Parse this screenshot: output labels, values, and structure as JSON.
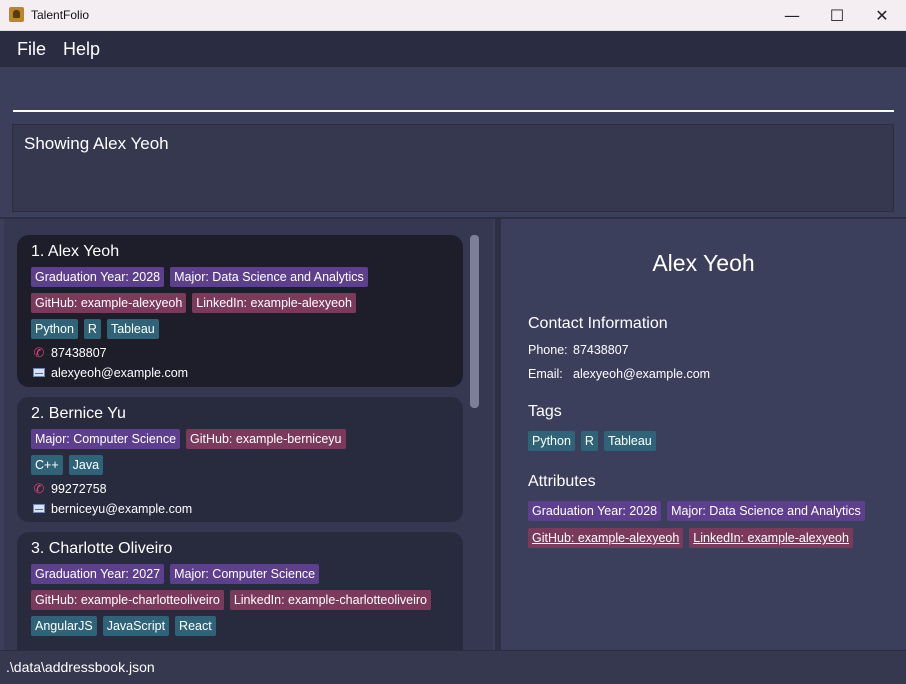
{
  "window": {
    "title": "TalentFolio",
    "minimize": "—",
    "maximize": "☐",
    "close": "✕"
  },
  "menu": {
    "file": "File",
    "help": "Help"
  },
  "command": {
    "value": ""
  },
  "result": {
    "text": "Showing Alex Yeoh"
  },
  "persons": [
    {
      "name": "1. Alex Yeoh",
      "attributes": [
        {
          "text": "Graduation Year: 2028",
          "color": "purple"
        },
        {
          "text": "Major: Data Science and Analytics",
          "color": "purple"
        },
        {
          "text": "GitHub: example-alexyeoh",
          "color": "maroon"
        },
        {
          "text": "LinkedIn: example-alexyeoh",
          "color": "maroon"
        }
      ],
      "tags": [
        "Python",
        "R",
        "Tableau"
      ],
      "phone": "87438807",
      "email": "alexyeoh@example.com"
    },
    {
      "name": "2. Bernice Yu",
      "attributes": [
        {
          "text": "Major: Computer Science",
          "color": "purple"
        },
        {
          "text": "GitHub: example-berniceyu",
          "color": "maroon"
        }
      ],
      "tags": [
        "C++",
        "Java"
      ],
      "phone": "99272758",
      "email": "berniceyu@example.com"
    },
    {
      "name": "3. Charlotte Oliveiro",
      "attributes": [
        {
          "text": "Graduation Year: 2027",
          "color": "purple"
        },
        {
          "text": "Major: Computer Science",
          "color": "purple"
        },
        {
          "text": "GitHub: example-charlotteoliveiro",
          "color": "maroon"
        },
        {
          "text": "LinkedIn: example-charlotteoliveiro",
          "color": "maroon"
        }
      ],
      "tags": [
        "AngularJS",
        "JavaScript",
        "React"
      ]
    }
  ],
  "detail": {
    "name": "Alex Yeoh",
    "contact_heading": "Contact Information",
    "phone_label": "Phone:",
    "phone": "87438807",
    "email_label": "Email:",
    "email": "alexyeoh@example.com",
    "tags_heading": "Tags",
    "tags": [
      "Python",
      "R",
      "Tableau"
    ],
    "attributes_heading": "Attributes",
    "attributes": [
      "Graduation Year: 2028",
      "Major: Data Science and Analytics",
      "GitHub: example-alexyeoh",
      "LinkedIn: example-alexyeoh"
    ]
  },
  "status": {
    "path": ".\\data\\addressbook.json"
  },
  "colors": {
    "purple": "#5e3f8e",
    "maroon": "#7b3a5c",
    "teal": "#2f6478",
    "background": "#3c3f5c",
    "card_selected": "#1e1e2b"
  }
}
